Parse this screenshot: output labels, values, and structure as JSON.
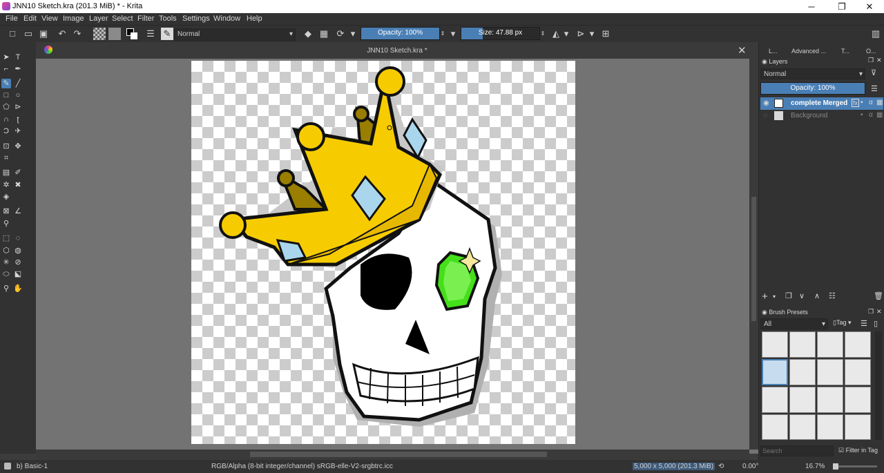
{
  "window": {
    "title": "JNN10 Sketch.kra (201.3 MiB)  * - Krita"
  },
  "menu": [
    "File",
    "Edit",
    "View",
    "Image",
    "Layer",
    "Select",
    "Filter",
    "Tools",
    "Settings",
    "Window",
    "Help"
  ],
  "toolbar": {
    "blend_mode": "Normal",
    "opacity_label": "Opacity: 100%",
    "opacity_value": 1.0,
    "size_label": "Size: 47.88 px",
    "size_fill": 0.27
  },
  "document": {
    "tab_title": "JNN10 Sketch.kra *"
  },
  "dock": {
    "tabs": [
      "L...",
      "Advanced ...",
      "T...",
      "O..."
    ],
    "layers": {
      "title": "Layers",
      "blend_mode": "Normal",
      "opacity_label": "Opacity:  100%",
      "items": [
        {
          "name": "complete Merged",
          "selected": true
        },
        {
          "name": "Background",
          "selected": false
        }
      ]
    },
    "brush_presets": {
      "title": "Brush Presets",
      "filter": "All",
      "tag_label": "Tag",
      "search_placeholder": "Search",
      "filter_in_tag": "Filter in Tag"
    }
  },
  "status": {
    "preset_name": "b) Basic-1",
    "color_info": "RGB/Alpha (8-bit integer/channel)  sRGB-elle-V2-srgbtrc.icc",
    "image_size": "5,000 x 5,000 (201.3 MiB)",
    "rotation": "0.00°",
    "zoom": "16.7%"
  },
  "colors": {
    "accent": "#4a7fb5",
    "crown": "#f6cc00",
    "gem": "#44e01a",
    "panel": "#323232"
  }
}
